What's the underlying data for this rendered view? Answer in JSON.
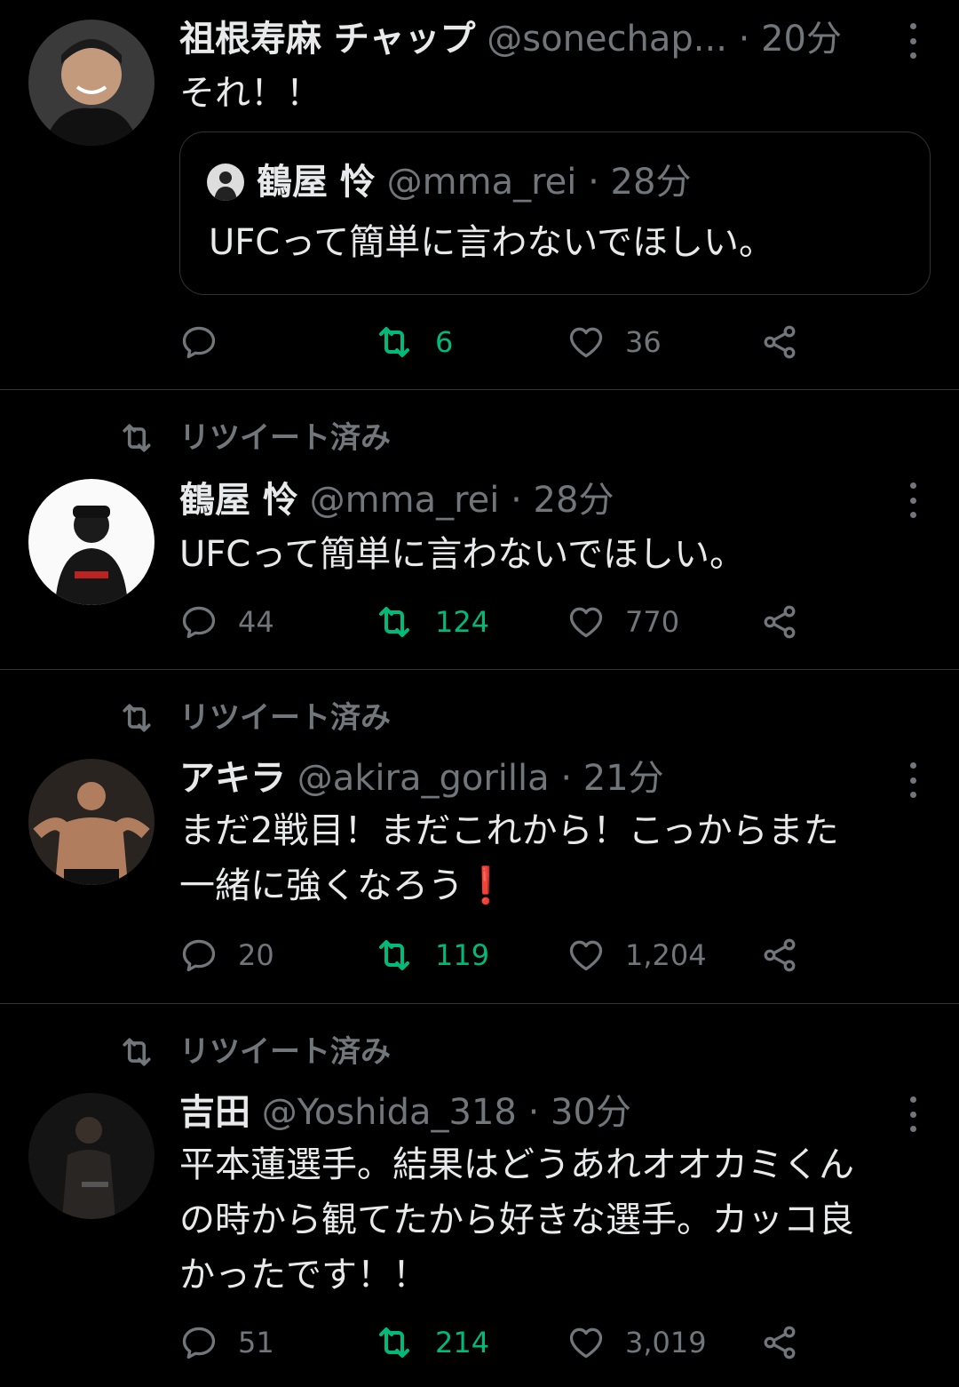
{
  "tweets": [
    {
      "name": "祖根寿麻 チャップ",
      "handle": "@sonechap...",
      "time": "· 20分",
      "text": "それ！！",
      "quote": {
        "name": "鶴屋 怜",
        "handle": "@mma_rei",
        "time": "· 28分",
        "text": "UFCって簡単に言わないでほしい。"
      },
      "replies": "",
      "retweets": "6",
      "likes": "36"
    },
    {
      "retweeted_label": "リツイート済み",
      "name": "鶴屋 怜",
      "handle": "@mma_rei",
      "time": "· 28分",
      "text": "UFCって簡単に言わないでほしい。",
      "replies": "44",
      "retweets": "124",
      "likes": "770"
    },
    {
      "retweeted_label": "リツイート済み",
      "name": "アキラ",
      "handle": "@akira_gorilla",
      "time": "· 21分",
      "text_line1": "まだ2戦目！まだこれから！こっからまた",
      "text_line2": "一緒に強くなろう",
      "text_emoji": "❗",
      "replies": "20",
      "retweets": "119",
      "likes": "1,204"
    },
    {
      "retweeted_label": "リツイート済み",
      "name": "吉田",
      "handle": "@Yoshida_318",
      "time": "· 30分",
      "text_line1": "平本蓮選手。結果はどうあれオオカミくん",
      "text_line2": "の時から観てたから好きな選手。カッコ良",
      "text_line3": "かったです！！",
      "replies": "51",
      "retweets": "214",
      "likes": "3,019"
    }
  ],
  "colors": {
    "background": "#000000",
    "text": "#e7e9ea",
    "secondary": "#71767b",
    "retweet_active": "#00ba7c",
    "divider": "#2f3336"
  },
  "icons": [
    "reply-icon",
    "retweet-icon",
    "like-icon",
    "share-icon",
    "more-icon"
  ]
}
